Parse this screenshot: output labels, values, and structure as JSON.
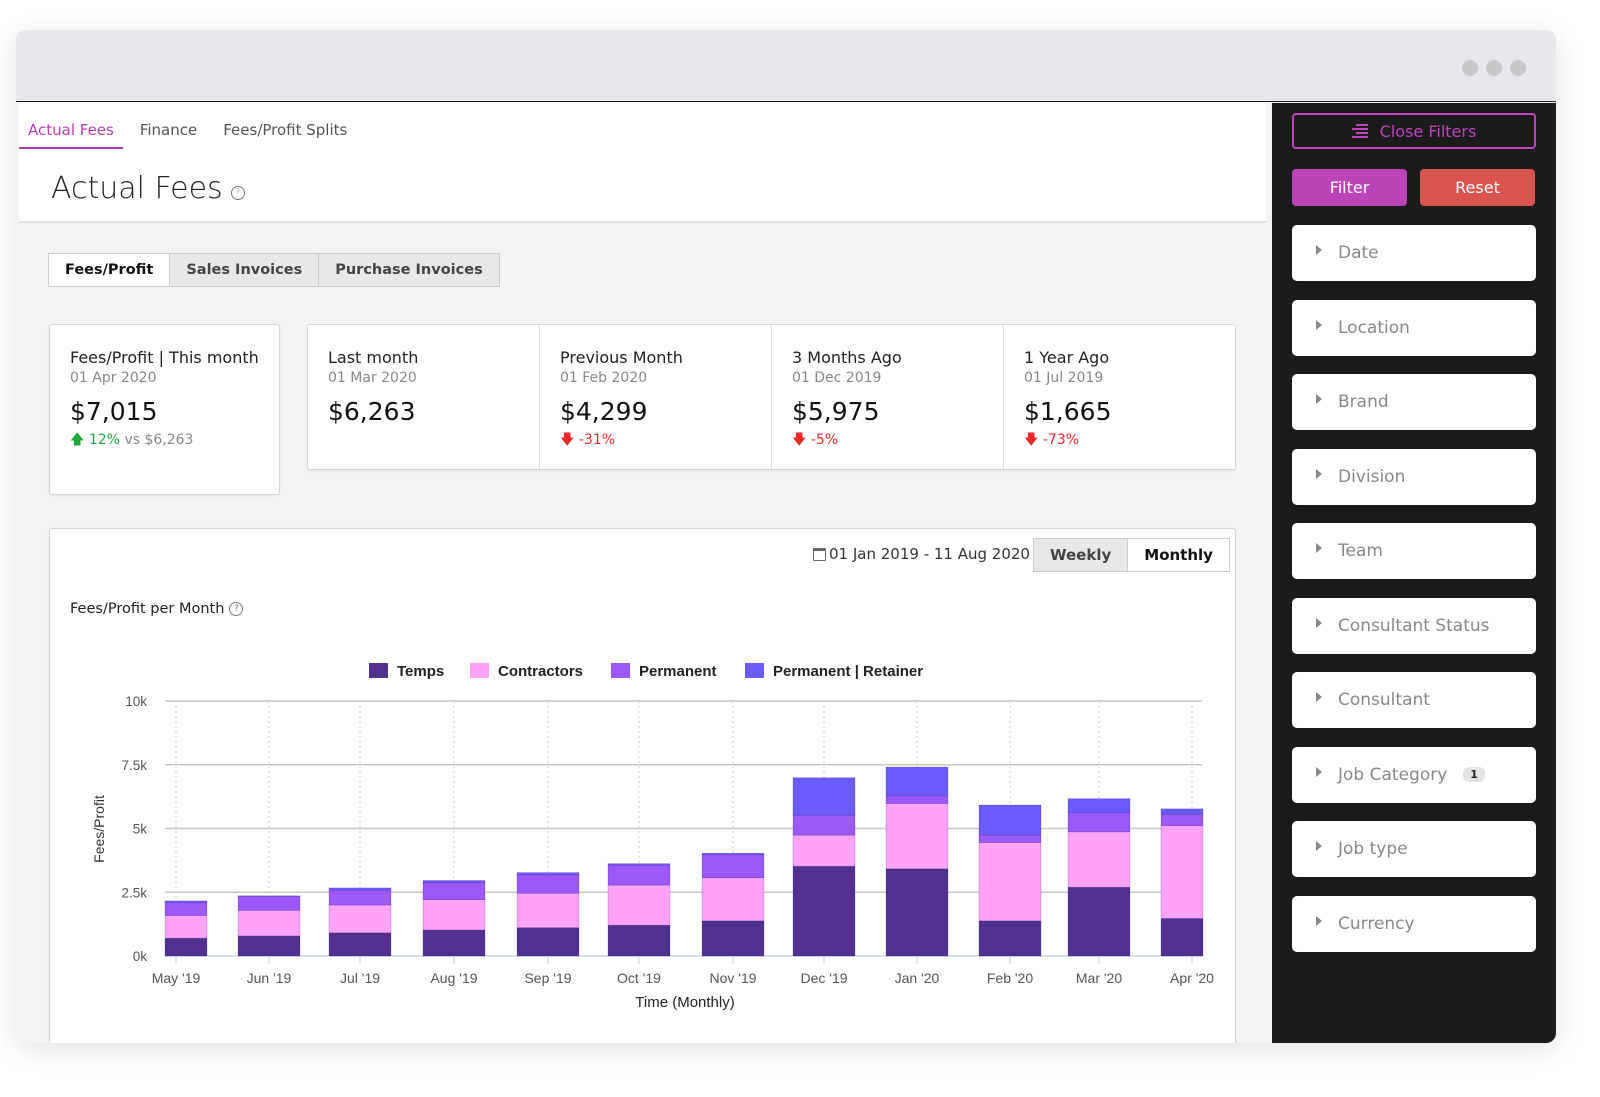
{
  "nav": {
    "tabs": [
      {
        "label": "Actual Fees",
        "active": true
      },
      {
        "label": "Finance",
        "active": false
      },
      {
        "label": "Fees/Profit Splits",
        "active": false
      }
    ]
  },
  "page": {
    "title": "Actual Fees",
    "help_icon": "question-circle-icon"
  },
  "subtabs": [
    {
      "label": "Fees/Profit",
      "active": true
    },
    {
      "label": "Sales Invoices",
      "active": false
    },
    {
      "label": "Purchase Invoices",
      "active": false
    }
  ],
  "kpi_main": {
    "label": "Fees/Profit | This month",
    "date": "01 Apr 2020",
    "value": "$7,015",
    "delta": "12%",
    "delta_direction": "up",
    "comparison": "vs $6,263"
  },
  "kpis": [
    {
      "label": "Last month",
      "date": "01 Mar 2020",
      "value": "$6,263",
      "delta": ""
    },
    {
      "label": "Previous Month",
      "date": "01 Feb 2020",
      "value": "$4,299",
      "delta": "-31%"
    },
    {
      "label": "3 Months Ago",
      "date": "01 Dec 2019",
      "value": "$5,975",
      "delta": "-5%"
    },
    {
      "label": "1 Year Ago",
      "date": "01 Jul 2019",
      "value": "$1,665",
      "delta": "-73%"
    }
  ],
  "chart_panel": {
    "date_range": "01 Jan 2019 - 11 Aug 2020",
    "period_options": [
      {
        "label": "Weekly",
        "active": false
      },
      {
        "label": "Monthly",
        "active": true
      }
    ],
    "title": "Fees/Profit per Month"
  },
  "chart_data": {
    "type": "bar",
    "stacked": true,
    "title": "Fees/Profit per Month",
    "xlabel": "Time (Monthly)",
    "ylabel": "Fees/Profit",
    "ylim": [
      0,
      10000
    ],
    "yticks": [
      "0k",
      "2.5k",
      "5k",
      "7.5k",
      "10k"
    ],
    "ytick_values": [
      0,
      2500,
      5000,
      7500,
      10000
    ],
    "grid": true,
    "legend_position": "top-center",
    "categories": [
      "May '19",
      "Jun '19",
      "Jul '19",
      "Aug '19",
      "Sep '19",
      "Oct '19",
      "Nov '19",
      "Dec '19",
      "Jan '20",
      "Feb '20",
      "Mar '20",
      "Apr '20"
    ],
    "series": [
      {
        "name": "Temps",
        "color": "#51318f",
        "values": [
          700,
          790,
          910,
          1020,
          1110,
          1210,
          1380,
          3520,
          3420,
          1380,
          2700,
          1470
        ]
      },
      {
        "name": "Contractors",
        "color": "#ffa3f8",
        "values": [
          890,
          1000,
          1090,
          1190,
          1350,
          1570,
          1690,
          1220,
          2560,
          3070,
          2170,
          3640
        ]
      },
      {
        "name": "Permanent",
        "color": "#9c59f7",
        "values": [
          500,
          550,
          580,
          660,
          720,
          780,
          900,
          780,
          300,
          290,
          760,
          450
        ]
      },
      {
        "name": "Permanent | Retainer",
        "color": "#6c5bfc",
        "values": [
          70,
          20,
          90,
          90,
          90,
          60,
          60,
          1470,
          1130,
          1180,
          540,
          210
        ]
      }
    ]
  },
  "sidebar": {
    "close_label": "Close Filters",
    "filter_label": "Filter",
    "reset_label": "Reset",
    "filters": [
      {
        "label": "Date",
        "badge": ""
      },
      {
        "label": "Location",
        "badge": ""
      },
      {
        "label": "Brand",
        "badge": ""
      },
      {
        "label": "Division",
        "badge": ""
      },
      {
        "label": "Team",
        "badge": ""
      },
      {
        "label": "Consultant Status",
        "badge": ""
      },
      {
        "label": "Consultant",
        "badge": ""
      },
      {
        "label": "Job Category",
        "badge": "1"
      },
      {
        "label": "Job type",
        "badge": ""
      },
      {
        "label": "Currency",
        "badge": ""
      }
    ]
  },
  "colors": {
    "accent": "#b43fb5",
    "filter_button": "#bc44b9",
    "reset_button": "#d9534f",
    "up": "#1aaa3c",
    "down": "#f02828"
  }
}
